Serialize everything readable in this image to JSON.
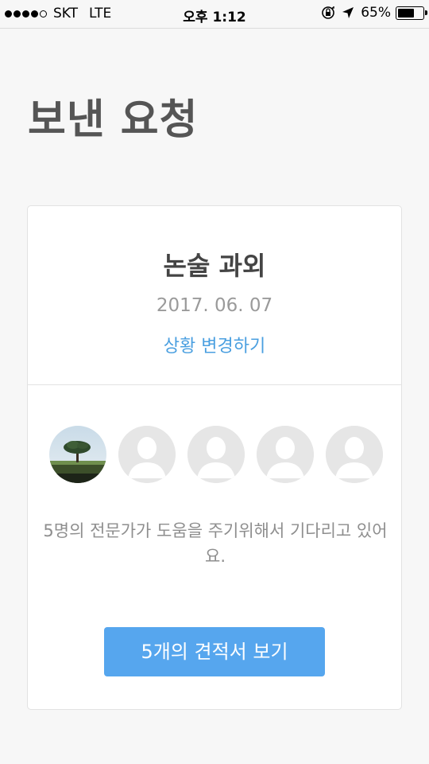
{
  "status_bar": {
    "carrier": "SKT",
    "network": "LTE",
    "time": "오후 1:12",
    "battery_percent": "65%",
    "battery_level": 0.65,
    "icons": [
      "signal-dots-icon",
      "rotation-lock-icon",
      "location-arrow-icon",
      "battery-icon"
    ]
  },
  "page": {
    "title": "보낸 요청"
  },
  "request": {
    "title": "논술 과외",
    "date": "2017. 06. 07",
    "status_link": "상황 변경하기",
    "helper_text": "5명의 전문가가 도움을 주기위해서 기다리고 있어요.",
    "button_label": "5개의 견적서 보기",
    "experts": [
      {
        "type": "photo",
        "icon": "tree-landscape-photo"
      },
      {
        "type": "placeholder",
        "icon": "default-avatar-icon"
      },
      {
        "type": "placeholder",
        "icon": "default-avatar-icon"
      },
      {
        "type": "placeholder",
        "icon": "default-avatar-icon"
      },
      {
        "type": "placeholder",
        "icon": "default-avatar-icon"
      }
    ]
  },
  "colors": {
    "accent": "#56a6ee",
    "link": "#4a9fe0",
    "background": "#f7f7f7",
    "title": "#555555"
  }
}
